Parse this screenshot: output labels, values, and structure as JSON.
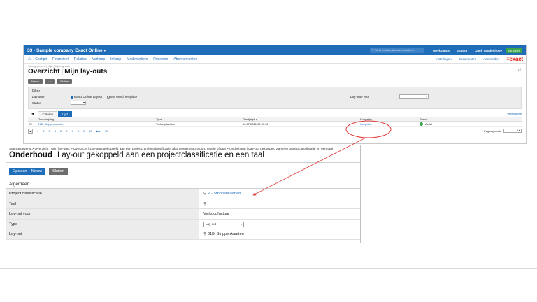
{
  "app": {
    "company": "33 - Sample company Exact Online",
    "search_placeholder": "Vind relaties, facturen, boeken...",
    "top_links": [
      "Werkplaats",
      "Support"
    ],
    "user": "Jack Vandenhove",
    "badge": "Nu kopen",
    "logo": "≡exact"
  },
  "nav": {
    "items": [
      "Cockpit",
      "Financieel",
      "Relaties",
      "Verkoop",
      "Inkoop",
      "Medewerkers",
      "Projecten",
      "Abonnementen"
    ],
    "right_items": [
      "Instellingen",
      "Documenten",
      "Aanmelden"
    ]
  },
  "page": {
    "crumb": "Stamgegevens | Mijn | Mijn lay-outs",
    "title_left": "Overzicht",
    "title_right": "Mijn lay-outs",
    "sort": "↓↑"
  },
  "buttons": {
    "nieuw": "Nieuw",
    "more": "···",
    "sluiten": "Sluiten"
  },
  "filter": {
    "title": "Filter",
    "layout_label": "Lay-oute",
    "radio1": "Exact Online Layout",
    "radio2": "MS Word Template",
    "status_label": "Status",
    "layout_voor_label": "Lay-oute voor"
  },
  "tabs": {
    "arrow": "◀",
    "items": [
      "Colomn",
      "Lijst"
    ],
    "right": "Verwijderen"
  },
  "grid": {
    "headers": [
      "",
      "Omschrijving",
      "Type",
      "Gewijzigd ▴",
      "Koppelen",
      "Status"
    ],
    "rows": [
      {
        "desc": "01B. Strippenkaarten",
        "type": "Verkoopfactuur",
        "date": "06.07.2021 17:03:36",
        "link": "Koppelen",
        "status": "Actief"
      }
    ]
  },
  "pager": {
    "pages": [
      "◀",
      "1",
      "2",
      "3",
      "4",
      "5",
      "6",
      "7",
      "8",
      "9",
      "10",
      "▶▶",
      "90"
    ],
    "size_label": "Paginagrootte",
    "size_value": "4"
  },
  "detail": {
    "crumb": "Stamgegevens > Overzicht | Mijn lay-outs > Overzicht | Lay-outs gekoppeld aan een project, projectclassificatie, abonnementsoortsoort, relatie of taal > Onderhoud | Lay-out gekoppeld aan een projectclassificatie en een taal",
    "title_left": "Onderhoud",
    "title_right": "Lay-out gekoppeld aan een projectclassificatie en een taal",
    "save_new": "Opslaan + Nieuw",
    "close": "Sluiten",
    "section": "Algemeen",
    "fields": [
      {
        "label": "Project classificatie",
        "value": "P - Strippenkaarten"
      },
      {
        "label": "Taal",
        "value": ""
      },
      {
        "label": "Lay-out voor",
        "value": "Verkoopfactuur"
      },
      {
        "label": "Type",
        "value": "Lay-out"
      },
      {
        "label": "Lay-out",
        "value": "01B. Strippenkaarten"
      }
    ]
  },
  "colors": {
    "brand_blue": "#1f6db8",
    "exact_red": "#e1261c",
    "annotation_red": "#e23a3a",
    "active_green": "#3aa54a"
  }
}
